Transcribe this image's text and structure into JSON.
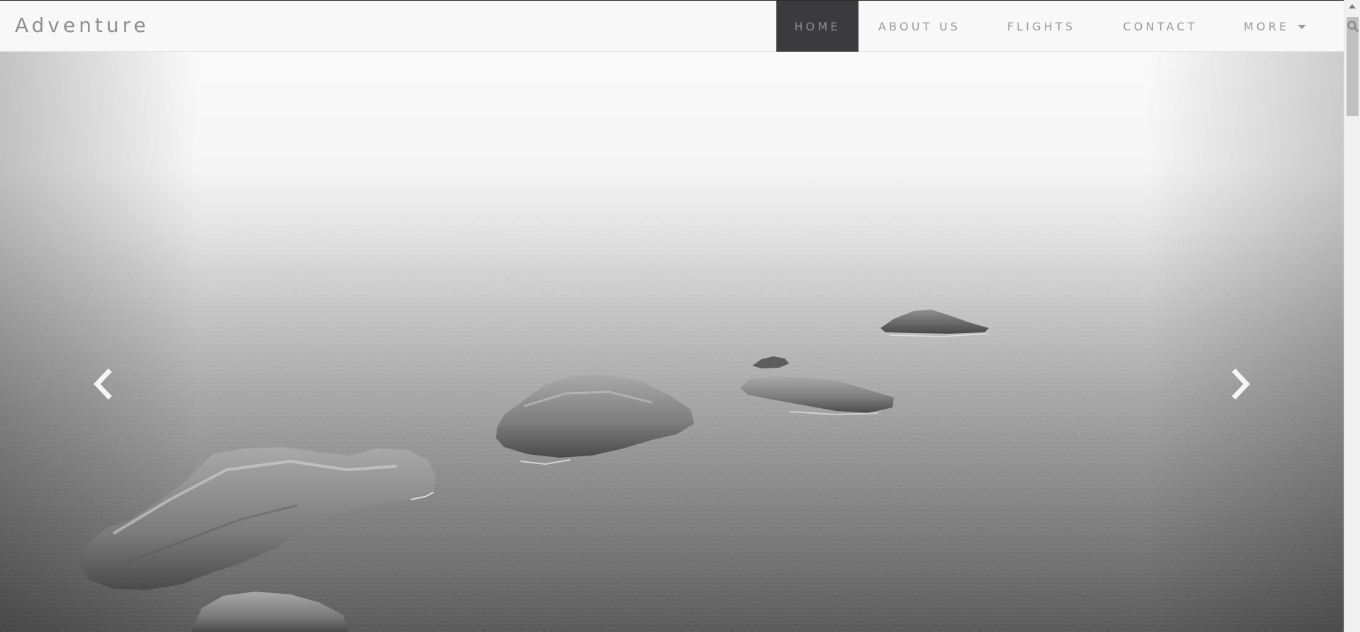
{
  "brand": {
    "name": "Adventure"
  },
  "nav": {
    "items": [
      {
        "label": "HOME",
        "active": true
      },
      {
        "label": "ABOUT US",
        "active": false
      },
      {
        "label": "FLIGHTS",
        "active": false
      },
      {
        "label": "CONTACT",
        "active": false
      },
      {
        "label": "MORE",
        "active": false,
        "has_dropdown": true
      }
    ],
    "search_icon": "search-icon"
  },
  "carousel": {
    "prev_icon": "chevron-left-icon",
    "next_icon": "chevron-right-icon",
    "slide_image": "rocky-islands-in-misty-sea"
  },
  "colors": {
    "nav_bg": "#f8f8f8",
    "nav_active_bg": "#3b3b3e",
    "nav_text": "#9a9a9a",
    "brand_text": "#8f8f8f"
  }
}
